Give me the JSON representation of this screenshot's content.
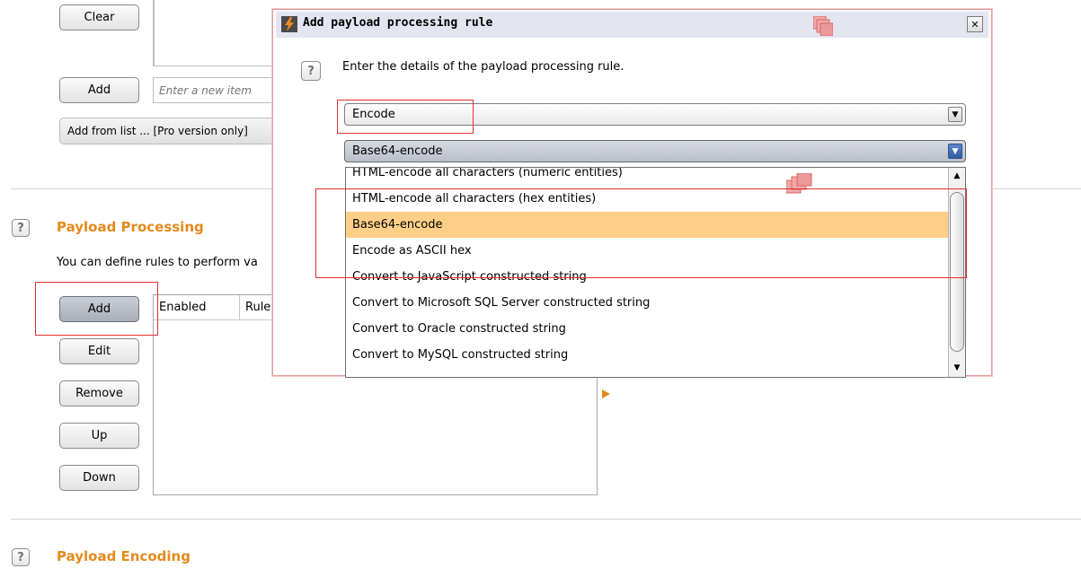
{
  "top_section": {
    "clear_button": "Clear",
    "add_button": "Add",
    "new_item_placeholder": "Enter a new item",
    "add_from_list_button": "Add from list ... [Pro version only]"
  },
  "payload_processing": {
    "title": "Payload Processing",
    "description": "You can define rules to perform va",
    "buttons": {
      "add": "Add",
      "edit": "Edit",
      "remove": "Remove",
      "up": "Up",
      "down": "Down"
    },
    "table_headers": [
      "Enabled",
      "Rule"
    ]
  },
  "payload_encoding": {
    "title": "Payload Encoding"
  },
  "dialog": {
    "title": "Add payload processing rule",
    "close_glyph": "✕",
    "prompt": "Enter the details of the payload processing rule.",
    "rule_type": "Encode",
    "encoding_selected": "Base64-encode",
    "options": [
      "HTML-encode all characters (numeric entities)",
      "HTML-encode all characters (hex entities)",
      "Base64-encode",
      "Encode as ASCII hex",
      "Convert to JavaScript constructed string",
      "Convert to Microsoft SQL Server constructed string",
      "Convert to Oracle constructed string",
      "Convert to MySQL constructed string"
    ],
    "selected_option_index": 2
  },
  "colors": {
    "section_title": "#e38a1c",
    "selected_row": "#ffcf87",
    "annotation_red": "#e0302e",
    "dialog_border": "#e89a9a"
  },
  "icons": [
    "help-icon",
    "burp-logo-icon",
    "close-icon",
    "chevron-down-icon",
    "scroll-up-icon",
    "scroll-down-icon",
    "play-arrow-icon",
    "window-overlay-icon"
  ]
}
